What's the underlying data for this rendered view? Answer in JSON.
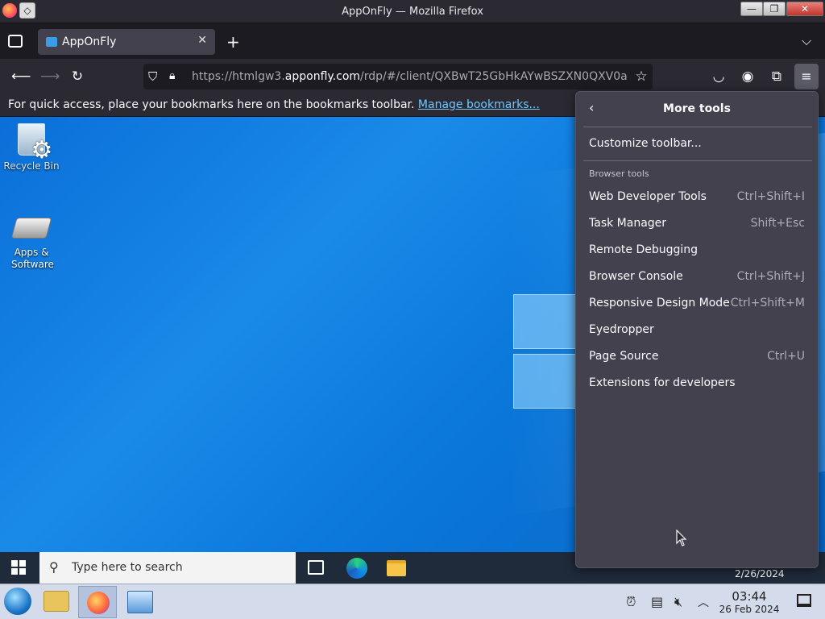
{
  "window": {
    "title": "AppOnFly — Mozilla Firefox",
    "minimize": "—",
    "maximize": "❐",
    "close": "✕"
  },
  "tabs": [
    {
      "label": "AppOnFly",
      "close": "✕"
    }
  ],
  "toolbar": {
    "new_tab": "+",
    "list_tabs": "⌵",
    "url_prefix": "https://htmlgw3.",
    "url_domain": "apponfly.com",
    "url_suffix": "/rdp/#/client/QXBwT25GbHkAYwBSZXN0QXV0a"
  },
  "bookmarks_bar": {
    "message": "For quick access, place your bookmarks here on the bookmarks toolbar.",
    "link": "Manage bookmarks..."
  },
  "menu": {
    "title": "More tools",
    "back": "‹",
    "customize": "Customize toolbar...",
    "section": "Browser tools",
    "items": [
      {
        "label": "Web Developer Tools",
        "shortcut": "Ctrl+Shift+I"
      },
      {
        "label": "Task Manager",
        "shortcut": "Shift+Esc"
      },
      {
        "label": "Remote Debugging",
        "shortcut": ""
      },
      {
        "label": "Browser Console",
        "shortcut": "Ctrl+Shift+J"
      },
      {
        "label": "Responsive Design Mode",
        "shortcut": "Ctrl+Shift+M"
      },
      {
        "label": "Eyedropper",
        "shortcut": ""
      },
      {
        "label": "Page Source",
        "shortcut": "Ctrl+U"
      },
      {
        "label": "Extensions for developers",
        "shortcut": ""
      }
    ]
  },
  "desktop": {
    "icons": [
      {
        "label": "Recycle Bin"
      },
      {
        "label": "Apps & Software"
      }
    ]
  },
  "remote_taskbar": {
    "search_placeholder": "Type here to search",
    "date": "2/26/2024"
  },
  "host_taskbar": {
    "time": "03:44",
    "date": "26 Feb 2024"
  }
}
